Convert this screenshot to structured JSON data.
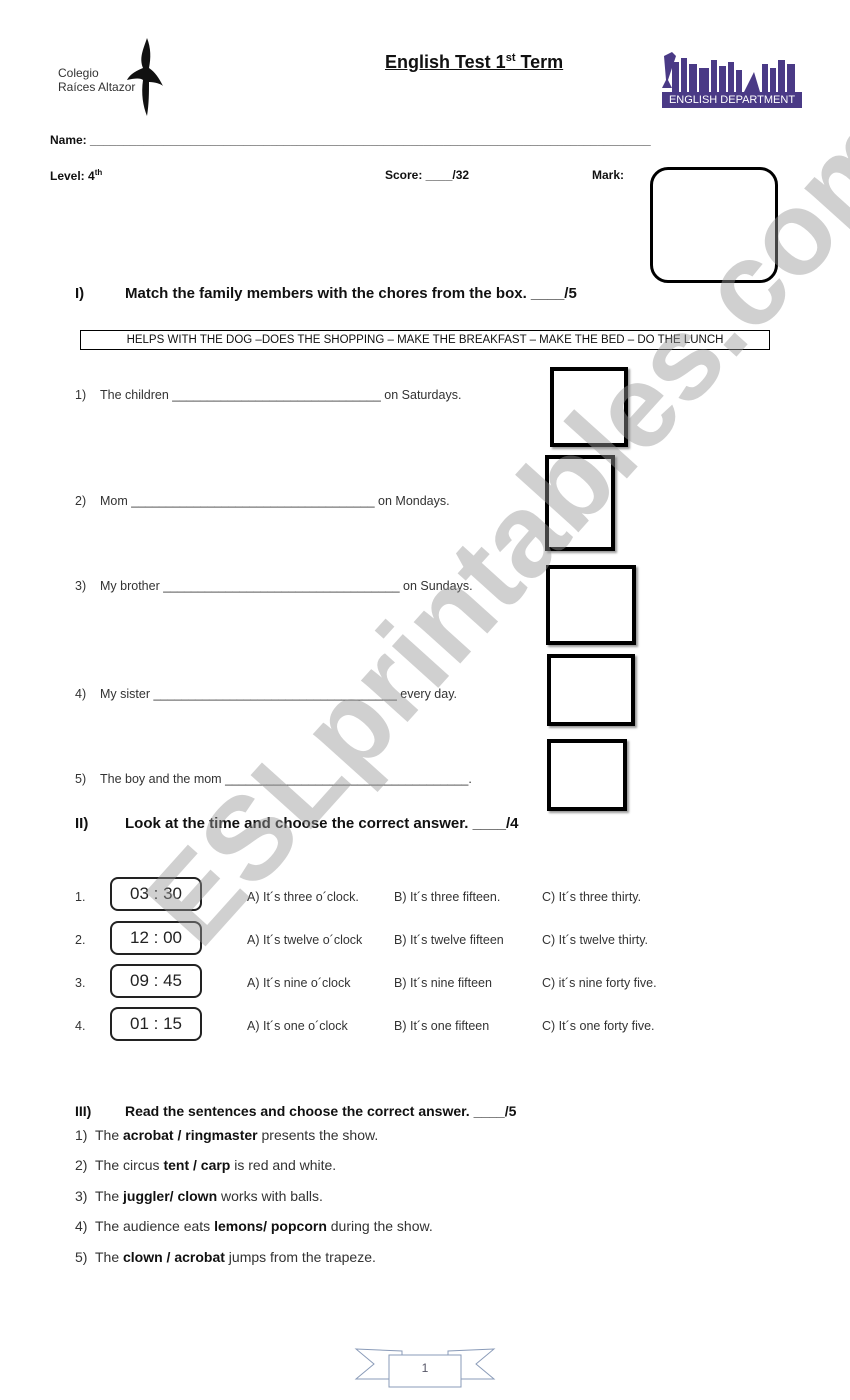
{
  "header": {
    "school_line1": "Colegio",
    "school_line2": "Raíces Altazor",
    "title_main": "English Test 1",
    "title_sup": "st",
    "title_end": " Term",
    "dept_label": "ENGLISH DEPARTMENT",
    "name_label": "Name: ____________________________________________________________________________________",
    "level_label": "Level: 4",
    "level_sup": "th",
    "score_label": "Score: ____/32",
    "mark_label": "Mark:"
  },
  "section1": {
    "numeral": "I)",
    "title": "Match the family members with the chores from the box. ____/5",
    "chores": "HELPS WITH THE DOG –DOES THE SHOPPING – MAKE THE BREAKFAST – MAKE THE BED – DO THE LUNCH",
    "items": [
      {
        "num": "1)",
        "text": "The children ______________________________ on Saturdays."
      },
      {
        "num": "2)",
        "text": "Mom ___________________________________ on Mondays."
      },
      {
        "num": "3)",
        "text": "My brother __________________________________ on Sundays."
      },
      {
        "num": "4)",
        "text": "My sister ___________________________________ every day."
      },
      {
        "num": "5)",
        "text": "The boy and the mom ___________________________________."
      }
    ]
  },
  "section2": {
    "numeral": "II)",
    "title": "Look at the time and choose the correct answer. ____/4",
    "items": [
      {
        "num": "1.",
        "time": "03 : 30",
        "a": "A) It´s three o´clock.",
        "b": "B) It´s three fifteen.",
        "c": "C) It´s three thirty."
      },
      {
        "num": "2.",
        "time": "12 : 00",
        "a": "A) It´s twelve o´clock",
        "b": "B) It´s twelve fifteen",
        "c": "C) It´s twelve thirty."
      },
      {
        "num": "3.",
        "time": "09 : 45",
        "a": "A) It´s nine o´clock",
        "b": "B) It´s nine fifteen",
        "c": "C) it´s nine forty five."
      },
      {
        "num": "4.",
        "time": "01 : 15",
        "a": "A) It´s one o´clock",
        "b": "B) It´s one fifteen",
        "c": "C) It´s one forty five."
      }
    ]
  },
  "section3": {
    "numeral": "III)",
    "title": "Read the sentences and choose the correct answer. ____/5",
    "items": [
      {
        "num": "1)",
        "pre": "The ",
        "bold": "acrobat / ringmaster",
        "post": " presents the show."
      },
      {
        "num": "2)",
        "pre": "The circus ",
        "bold": "tent / carp",
        "post": " is red and white."
      },
      {
        "num": "3)",
        "pre": "The ",
        "bold": "juggler/ clown",
        "post": " works with balls."
      },
      {
        "num": "4)",
        "pre": "The audience eats ",
        "bold": "lemons/ popcorn",
        "post": " during the show."
      },
      {
        "num": "5)",
        "pre": "The ",
        "bold": "clown / acrobat",
        "post": " jumps from the trapeze."
      }
    ]
  },
  "footer": {
    "page_number": "1"
  },
  "watermark": "ESLprintables.com"
}
